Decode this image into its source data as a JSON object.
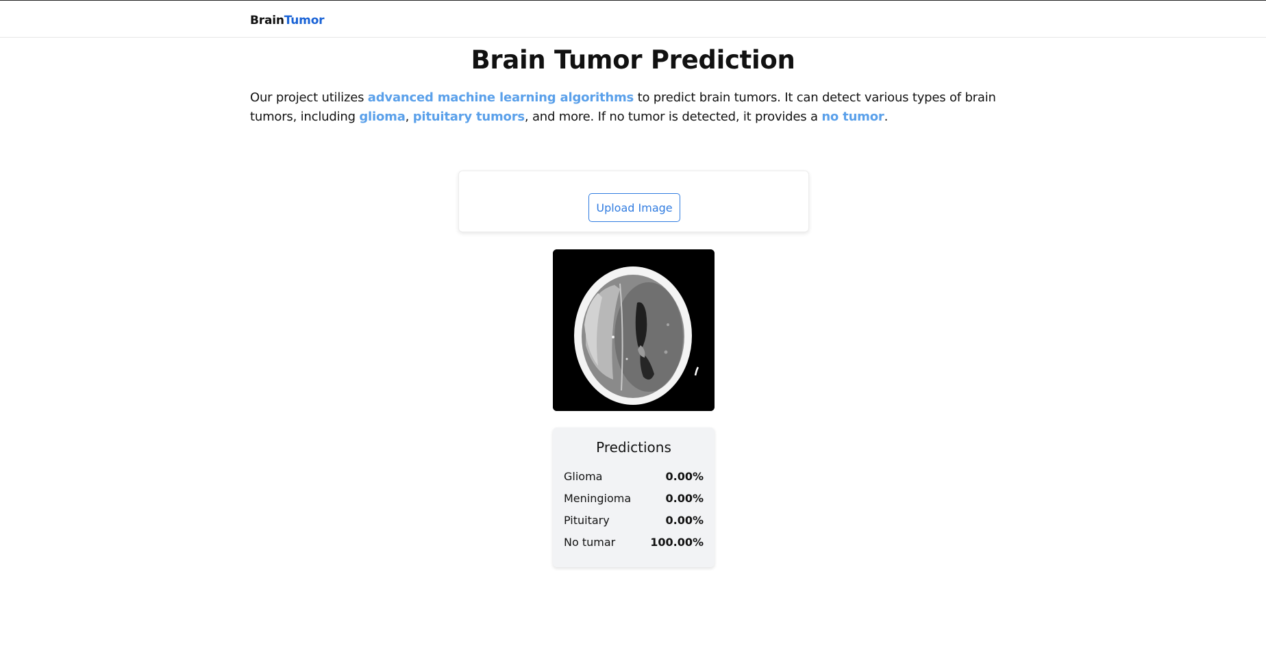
{
  "navbar": {
    "brand_part1": "Brain",
    "brand_part2": "Tumor",
    "brand_color": "#1a63d6"
  },
  "main": {
    "title": "Brain Tumor Prediction",
    "intro": {
      "t1": "Our project utilizes ",
      "h1": "advanced machine learning algorithms",
      "t2": " to predict brain tumors. It can detect various types of brain tumors, including ",
      "h2": "glioma",
      "t3": ", ",
      "h3": "pituitary tumors",
      "t4": ", and more. If no tumor is detected, it provides a ",
      "h4": "no tumor",
      "t5": "."
    },
    "highlight_color": "#5aa0ea"
  },
  "upload": {
    "button_label": "Upload Image",
    "accent_color": "#2f7be0"
  },
  "scan_image": {
    "icon": "brain-ct-scan-image"
  },
  "predictions": {
    "title": "Predictions",
    "rows": [
      {
        "label": "Glioma",
        "value": "0.00%"
      },
      {
        "label": "Meningioma",
        "value": "0.00%"
      },
      {
        "label": "Pituitary",
        "value": "0.00%"
      },
      {
        "label": "No tumar",
        "value": "100.00%"
      }
    ]
  }
}
